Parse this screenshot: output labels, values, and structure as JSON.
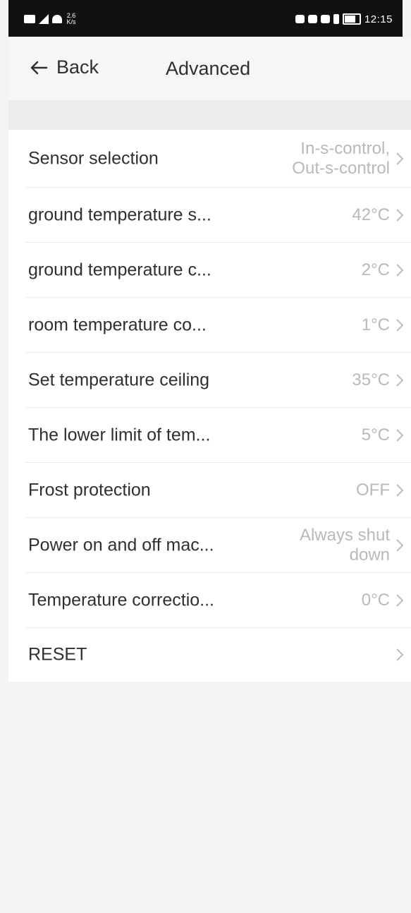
{
  "status_bar": {
    "speed_top": "2.6",
    "speed_bottom": "K/s",
    "time": "12:15"
  },
  "header": {
    "back_label": "Back",
    "title": "Advanced"
  },
  "settings": [
    {
      "label": "Sensor selection",
      "value_lines": [
        "In-s-control,",
        "Out-s-control"
      ]
    },
    {
      "label": "ground temperature s...",
      "value_lines": [
        "42°C"
      ]
    },
    {
      "label": "ground temperature c...",
      "value_lines": [
        "2°C"
      ]
    },
    {
      "label": "room temperature co...",
      "value_lines": [
        "1°C"
      ]
    },
    {
      "label": "Set temperature ceiling",
      "value_lines": [
        "35°C"
      ]
    },
    {
      "label": "The lower limit of tem...",
      "value_lines": [
        "5°C"
      ]
    },
    {
      "label": "Frost protection",
      "value_lines": [
        "OFF"
      ]
    },
    {
      "label": "Power on and off mac...",
      "value_lines": [
        "Always shut",
        "down"
      ]
    },
    {
      "label": "Temperature correctio...",
      "value_lines": [
        "0°C"
      ]
    },
    {
      "label": "RESET",
      "value_lines": []
    }
  ],
  "icons": {
    "back": "arrow-left-icon",
    "row_chevron": "chevron-right-icon"
  },
  "colors": {
    "status_bar_bg": "#111111",
    "label_text": "#2f2f2f",
    "value_text": "#b9b9b9",
    "page_bg": "#f4f4f6",
    "list_bg": "#ffffff"
  }
}
